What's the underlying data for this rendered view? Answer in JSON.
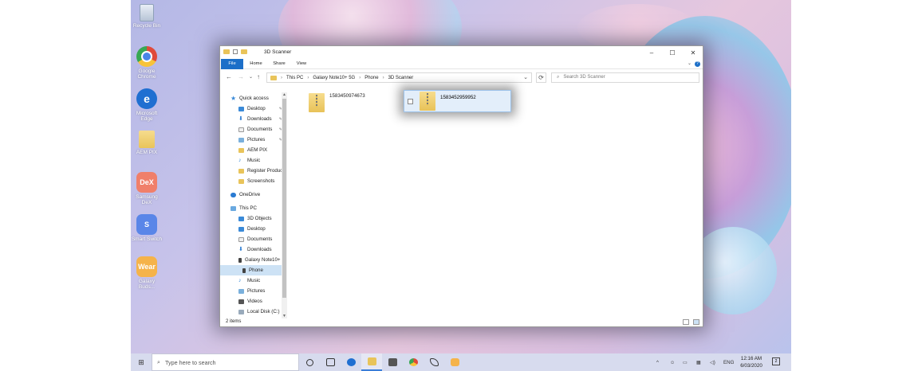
{
  "desktop": {
    "icons": [
      {
        "label": "Recycle Bin",
        "icon": "recycle-bin-icon"
      },
      {
        "label": "Google Chrome",
        "icon": "chrome-icon"
      },
      {
        "label": "Microsoft Edge",
        "icon": "edge-icon"
      },
      {
        "label": "AEM PIX",
        "icon": "folder-icon"
      },
      {
        "label": "Samsung DeX",
        "icon": "dex-icon",
        "glyph": "DeX"
      },
      {
        "label": "Smart Switch",
        "icon": "smart-switch-icon",
        "glyph": "S"
      },
      {
        "label": "Galaxy Buds...",
        "icon": "wear-icon",
        "glyph": "Wear"
      }
    ]
  },
  "window": {
    "title": "3D Scanner",
    "controls": {
      "minimize": "–",
      "maximize": "☐",
      "close": "✕"
    },
    "ribbon_tabs": [
      "File",
      "Home",
      "Share",
      "View"
    ],
    "help": "?",
    "nav": {
      "back": "←",
      "forward": "→",
      "recent": "⌄",
      "up": "↑",
      "refresh": "⟳"
    },
    "breadcrumb": [
      "This PC",
      "Galaxy Note10+ 5G",
      "Phone",
      "3D Scanner"
    ],
    "search_placeholder": "Search 3D Scanner",
    "nav_pane": [
      {
        "label": "Quick access",
        "icon": "star",
        "indent": 0
      },
      {
        "label": "Desktop",
        "icon": "blue",
        "indent": 1,
        "pinned": true
      },
      {
        "label": "Downloads",
        "icon": "dl",
        "indent": 1,
        "pinned": true
      },
      {
        "label": "Documents",
        "icon": "doc",
        "indent": 1,
        "pinned": true
      },
      {
        "label": "Pictures",
        "icon": "pic",
        "indent": 1,
        "pinned": true
      },
      {
        "label": "AEM PIX",
        "icon": "fold",
        "indent": 1
      },
      {
        "label": "Music",
        "icon": "music",
        "indent": 1
      },
      {
        "label": "Register Product",
        "icon": "fold",
        "indent": 1
      },
      {
        "label": "Screenshots",
        "icon": "fold",
        "indent": 1
      },
      {
        "label": "OneDrive",
        "icon": "cloud",
        "indent": 0
      },
      {
        "label": "This PC",
        "icon": "pc",
        "indent": 0
      },
      {
        "label": "3D Objects",
        "icon": "blue",
        "indent": 1
      },
      {
        "label": "Desktop",
        "icon": "blue",
        "indent": 1
      },
      {
        "label": "Documents",
        "icon": "doc",
        "indent": 1
      },
      {
        "label": "Downloads",
        "icon": "dl",
        "indent": 1
      },
      {
        "label": "Galaxy Note10+",
        "icon": "phone",
        "indent": 1
      },
      {
        "label": "Phone",
        "icon": "phone",
        "indent": 2,
        "selected": true
      },
      {
        "label": "Music",
        "icon": "music",
        "indent": 1
      },
      {
        "label": "Pictures",
        "icon": "pic",
        "indent": 1
      },
      {
        "label": "Videos",
        "icon": "vid",
        "indent": 1
      },
      {
        "label": "Local Disk (C:)",
        "icon": "disk",
        "indent": 1
      }
    ],
    "files": [
      {
        "name": "1583450974673"
      }
    ],
    "dragging_file": {
      "name": "1583452959952"
    },
    "status": "2 items"
  },
  "taskbar": {
    "start": "⊞",
    "search_placeholder": "Type here to search",
    "apps": [
      "cortana-icon",
      "task-view-icon",
      "edge-icon",
      "file-explorer-icon",
      "mail-icon",
      "chrome-icon",
      "flow-icon",
      "wear-icon"
    ],
    "active_app": "file-explorer-icon",
    "tray": {
      "chevron": "^",
      "language": "ENG"
    },
    "time": "12:16 AM",
    "date": "6/03/2020",
    "notifications": "2"
  }
}
